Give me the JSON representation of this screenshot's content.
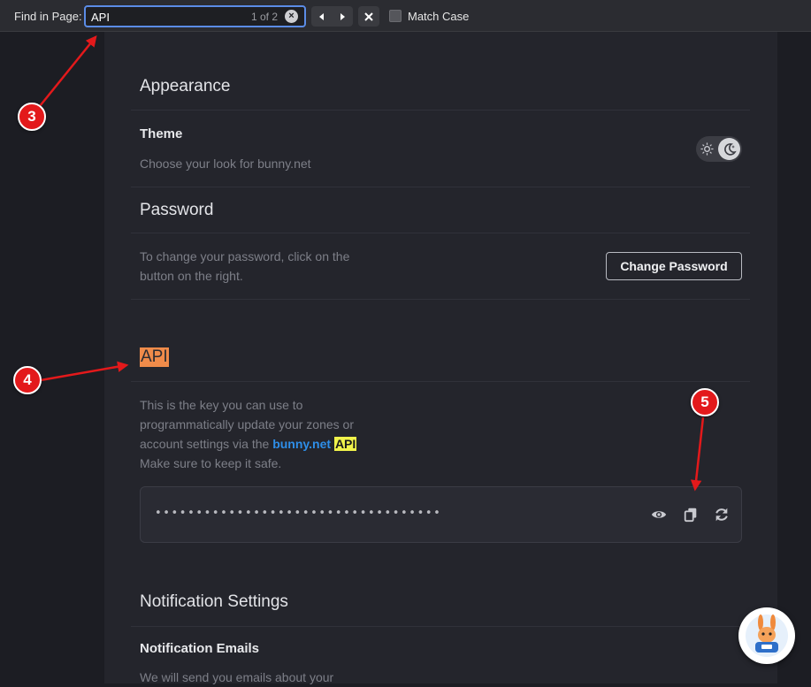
{
  "findbar": {
    "label": "Find in Page:",
    "query": "API",
    "count": "1 of 2",
    "match_case_label": "Match Case"
  },
  "appearance": {
    "title": "Appearance",
    "theme_label": "Theme",
    "theme_desc": "Choose your look for bunny.net"
  },
  "password": {
    "title": "Password",
    "desc_line1": "To change your password, click on the",
    "desc_line2": "button on the right.",
    "button_label": "Change Password"
  },
  "api": {
    "title": "API",
    "desc_line1": "This is the key you can use to",
    "desc_line2": "programmatically update your zones or",
    "desc_line3_prefix": "account settings via the ",
    "desc_brand": "bunny.net",
    "desc_api": "API",
    "desc_line4": "Make sure to keep it safe.",
    "key_masked": "•••••••••••••••••••••••••••••••••••"
  },
  "notifications": {
    "title": "Notification Settings",
    "emails_label": "Notification Emails",
    "emails_desc": "We will send you emails about your"
  },
  "annotations": [
    "3",
    "4",
    "5"
  ],
  "colors": {
    "find_highlight": "#ef8b4a",
    "match_highlight": "#f1f34b",
    "annotation_red": "#e3191b",
    "brand_blue": "#2e8ee8"
  }
}
